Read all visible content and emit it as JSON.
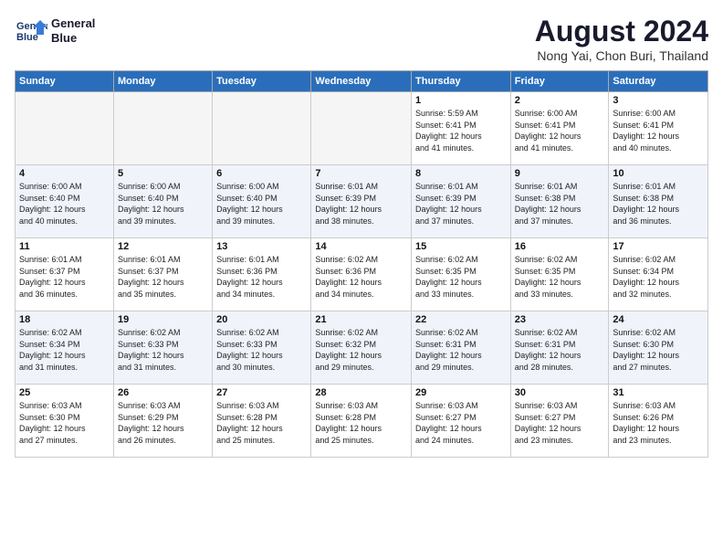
{
  "header": {
    "logo_line1": "General",
    "logo_line2": "Blue",
    "month_title": "August 2024",
    "location": "Nong Yai, Chon Buri, Thailand"
  },
  "weekdays": [
    "Sunday",
    "Monday",
    "Tuesday",
    "Wednesday",
    "Thursday",
    "Friday",
    "Saturday"
  ],
  "weeks": [
    [
      {
        "day": "",
        "info": ""
      },
      {
        "day": "",
        "info": ""
      },
      {
        "day": "",
        "info": ""
      },
      {
        "day": "",
        "info": ""
      },
      {
        "day": "1",
        "info": "Sunrise: 5:59 AM\nSunset: 6:41 PM\nDaylight: 12 hours\nand 41 minutes."
      },
      {
        "day": "2",
        "info": "Sunrise: 6:00 AM\nSunset: 6:41 PM\nDaylight: 12 hours\nand 41 minutes."
      },
      {
        "day": "3",
        "info": "Sunrise: 6:00 AM\nSunset: 6:41 PM\nDaylight: 12 hours\nand 40 minutes."
      }
    ],
    [
      {
        "day": "4",
        "info": "Sunrise: 6:00 AM\nSunset: 6:40 PM\nDaylight: 12 hours\nand 40 minutes."
      },
      {
        "day": "5",
        "info": "Sunrise: 6:00 AM\nSunset: 6:40 PM\nDaylight: 12 hours\nand 39 minutes."
      },
      {
        "day": "6",
        "info": "Sunrise: 6:00 AM\nSunset: 6:40 PM\nDaylight: 12 hours\nand 39 minutes."
      },
      {
        "day": "7",
        "info": "Sunrise: 6:01 AM\nSunset: 6:39 PM\nDaylight: 12 hours\nand 38 minutes."
      },
      {
        "day": "8",
        "info": "Sunrise: 6:01 AM\nSunset: 6:39 PM\nDaylight: 12 hours\nand 37 minutes."
      },
      {
        "day": "9",
        "info": "Sunrise: 6:01 AM\nSunset: 6:38 PM\nDaylight: 12 hours\nand 37 minutes."
      },
      {
        "day": "10",
        "info": "Sunrise: 6:01 AM\nSunset: 6:38 PM\nDaylight: 12 hours\nand 36 minutes."
      }
    ],
    [
      {
        "day": "11",
        "info": "Sunrise: 6:01 AM\nSunset: 6:37 PM\nDaylight: 12 hours\nand 36 minutes."
      },
      {
        "day": "12",
        "info": "Sunrise: 6:01 AM\nSunset: 6:37 PM\nDaylight: 12 hours\nand 35 minutes."
      },
      {
        "day": "13",
        "info": "Sunrise: 6:01 AM\nSunset: 6:36 PM\nDaylight: 12 hours\nand 34 minutes."
      },
      {
        "day": "14",
        "info": "Sunrise: 6:02 AM\nSunset: 6:36 PM\nDaylight: 12 hours\nand 34 minutes."
      },
      {
        "day": "15",
        "info": "Sunrise: 6:02 AM\nSunset: 6:35 PM\nDaylight: 12 hours\nand 33 minutes."
      },
      {
        "day": "16",
        "info": "Sunrise: 6:02 AM\nSunset: 6:35 PM\nDaylight: 12 hours\nand 33 minutes."
      },
      {
        "day": "17",
        "info": "Sunrise: 6:02 AM\nSunset: 6:34 PM\nDaylight: 12 hours\nand 32 minutes."
      }
    ],
    [
      {
        "day": "18",
        "info": "Sunrise: 6:02 AM\nSunset: 6:34 PM\nDaylight: 12 hours\nand 31 minutes."
      },
      {
        "day": "19",
        "info": "Sunrise: 6:02 AM\nSunset: 6:33 PM\nDaylight: 12 hours\nand 31 minutes."
      },
      {
        "day": "20",
        "info": "Sunrise: 6:02 AM\nSunset: 6:33 PM\nDaylight: 12 hours\nand 30 minutes."
      },
      {
        "day": "21",
        "info": "Sunrise: 6:02 AM\nSunset: 6:32 PM\nDaylight: 12 hours\nand 29 minutes."
      },
      {
        "day": "22",
        "info": "Sunrise: 6:02 AM\nSunset: 6:31 PM\nDaylight: 12 hours\nand 29 minutes."
      },
      {
        "day": "23",
        "info": "Sunrise: 6:02 AM\nSunset: 6:31 PM\nDaylight: 12 hours\nand 28 minutes."
      },
      {
        "day": "24",
        "info": "Sunrise: 6:02 AM\nSunset: 6:30 PM\nDaylight: 12 hours\nand 27 minutes."
      }
    ],
    [
      {
        "day": "25",
        "info": "Sunrise: 6:03 AM\nSunset: 6:30 PM\nDaylight: 12 hours\nand 27 minutes."
      },
      {
        "day": "26",
        "info": "Sunrise: 6:03 AM\nSunset: 6:29 PM\nDaylight: 12 hours\nand 26 minutes."
      },
      {
        "day": "27",
        "info": "Sunrise: 6:03 AM\nSunset: 6:28 PM\nDaylight: 12 hours\nand 25 minutes."
      },
      {
        "day": "28",
        "info": "Sunrise: 6:03 AM\nSunset: 6:28 PM\nDaylight: 12 hours\nand 25 minutes."
      },
      {
        "day": "29",
        "info": "Sunrise: 6:03 AM\nSunset: 6:27 PM\nDaylight: 12 hours\nand 24 minutes."
      },
      {
        "day": "30",
        "info": "Sunrise: 6:03 AM\nSunset: 6:27 PM\nDaylight: 12 hours\nand 23 minutes."
      },
      {
        "day": "31",
        "info": "Sunrise: 6:03 AM\nSunset: 6:26 PM\nDaylight: 12 hours\nand 23 minutes."
      }
    ]
  ]
}
